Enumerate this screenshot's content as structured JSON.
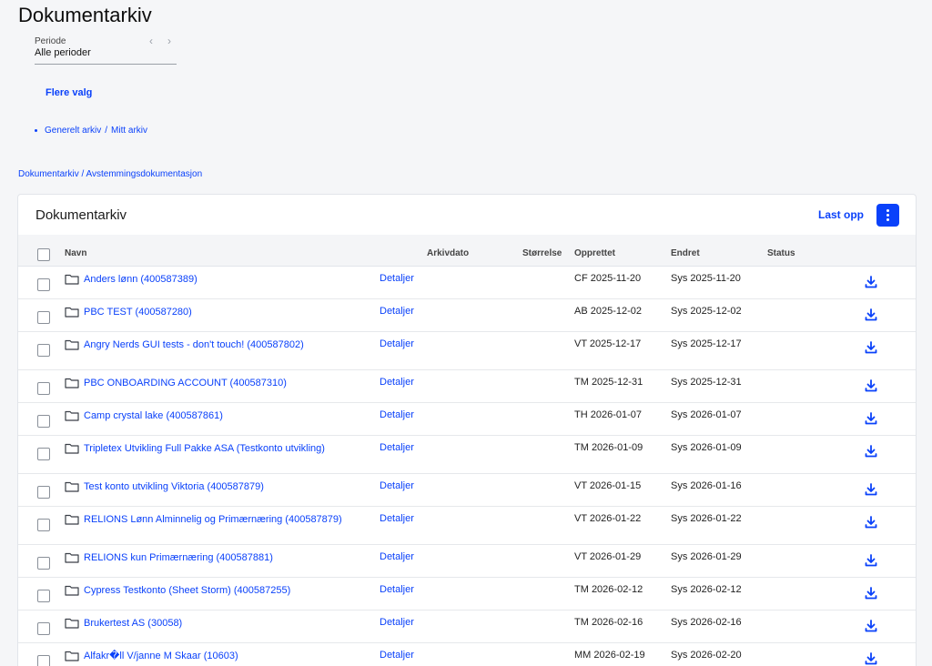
{
  "page": {
    "title": "Dokumentarkiv"
  },
  "period": {
    "label": "Periode",
    "value": "Alle perioder",
    "prev_icon": "chevron-left-icon",
    "next_icon": "chevron-right-icon"
  },
  "more_options": "Flere valg",
  "archive_links": {
    "general": "Generelt arkiv",
    "separator": "/",
    "mine": "Mitt arkiv"
  },
  "breadcrumb": {
    "root": "Dokumentarkiv",
    "separator": "/",
    "current": "Avstemmingsdokumentasjon"
  },
  "card": {
    "title": "Dokumentarkiv",
    "upload_label": "Last opp",
    "menu_icon": "kebab-menu-icon"
  },
  "table": {
    "columns": {
      "name": "Navn",
      "archive_date": "Arkivdato",
      "size": "Størrelse",
      "created": "Opprettet",
      "changed": "Endret",
      "status": "Status"
    },
    "rows": [
      {
        "name": "Anders lønn (400587389)",
        "details": "Detaljer",
        "created": "CF  2025-11-20",
        "changed": "Sys  2025-11-20"
      },
      {
        "name": "PBC TEST (400587280)",
        "details": "Detaljer",
        "created": "AB  2025-12-02",
        "changed": "Sys  2025-12-02"
      },
      {
        "name": "Angry Nerds GUI tests - don't touch! (400587802)",
        "details": "Detaljer",
        "created": "VT  2025-12-17",
        "changed": "Sys  2025-12-17"
      },
      {
        "name": "PBC ONBOARDING ACCOUNT (400587310)",
        "details": "Detaljer",
        "created": "TM  2025-12-31",
        "changed": "Sys  2025-12-31"
      },
      {
        "name": "Camp crystal lake (400587861)",
        "details": "Detaljer",
        "created": "TH  2026-01-07",
        "changed": "Sys  2026-01-07"
      },
      {
        "name": "Tripletex Utvikling Full Pakke ASA (Testkonto utvikling)",
        "details": "Detaljer",
        "created": "TM  2026-01-09",
        "changed": "Sys  2026-01-09"
      },
      {
        "name": "Test konto utvikling Viktoria (400587879)",
        "details": "Detaljer",
        "created": "VT  2026-01-15",
        "changed": "Sys  2026-01-16"
      },
      {
        "name": "RELIONS Lønn Alminnelig og Primærnæring (400587879)",
        "details": "Detaljer",
        "created": "VT  2026-01-22",
        "changed": "Sys  2026-01-22"
      },
      {
        "name": "RELIONS kun Primærnæring (400587881)",
        "details": "Detaljer",
        "created": "VT  2026-01-29",
        "changed": "Sys  2026-01-29"
      },
      {
        "name": "Cypress Testkonto (Sheet Storm) (400587255)",
        "details": "Detaljer",
        "created": "TM  2026-02-12",
        "changed": "Sys  2026-02-12"
      },
      {
        "name": "Brukertest AS (30058)",
        "details": "Detaljer",
        "created": "TM  2026-02-16",
        "changed": "Sys  2026-02-16"
      },
      {
        "name": "Alfakr�ll V/janne M Skaar (10603)",
        "details": "Detaljer",
        "created": "MM  2026-02-19",
        "changed": "Sys  2026-02-20"
      }
    ]
  },
  "icons": {
    "folder": "folder-icon",
    "download": "download-icon"
  },
  "colors": {
    "accent": "#0a41fa",
    "background": "#f5f6f8",
    "card": "#ffffff",
    "header_bg": "#f4f5f7"
  }
}
